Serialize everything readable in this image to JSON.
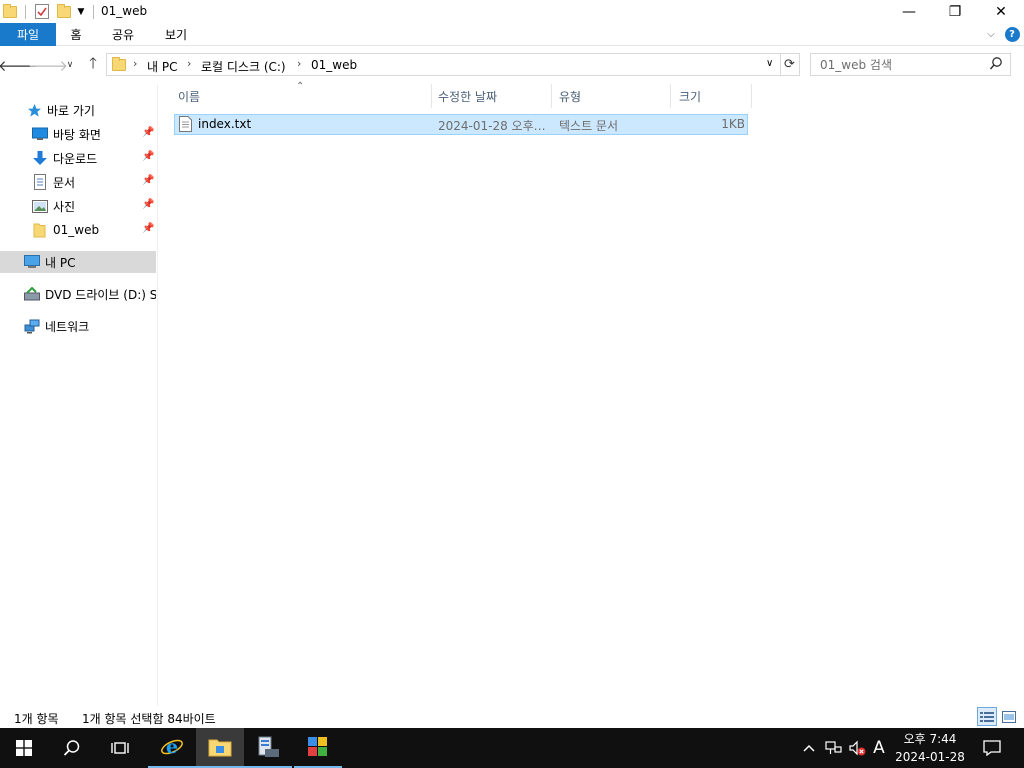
{
  "window": {
    "title": "01_web",
    "minimize": "—",
    "restore": "❐",
    "close": "✕"
  },
  "ribbon": {
    "tabs": [
      {
        "label": "파일"
      },
      {
        "label": "홈"
      },
      {
        "label": "공유"
      },
      {
        "label": "보기"
      }
    ],
    "accent": "#1979ca",
    "help": "?"
  },
  "address": {
    "crumbs": [
      "내 PC",
      "로컬 디스크 (C:)",
      "01_web"
    ]
  },
  "search": {
    "placeholder": "01_web 검색"
  },
  "nav": {
    "quick_access": "바로 가기",
    "items": [
      {
        "label": "바탕 화면",
        "icon": "desktop-icon"
      },
      {
        "label": "다운로드",
        "icon": "download-icon"
      },
      {
        "label": "문서",
        "icon": "documents-icon"
      },
      {
        "label": "사진",
        "icon": "pictures-icon"
      },
      {
        "label": "01_web",
        "icon": "folder-icon"
      }
    ],
    "this_pc": "내 PC",
    "dvd": "DVD 드라이브 (D:) S",
    "network": "네트워크"
  },
  "columns": {
    "name": "이름",
    "modified": "수정한 날짜",
    "type": "유형",
    "size": "크기"
  },
  "files": [
    {
      "name": "index.txt",
      "modified": "2024-01-28 오후…",
      "type": "텍스트 문서",
      "size": "1KB"
    }
  ],
  "status": {
    "count": "1개 항목",
    "selected": "1개 항목 선택함 84바이트"
  },
  "tray": {
    "ime": "A",
    "time": "오후 7:44",
    "date": "2024-01-28"
  },
  "colors": {
    "selection_bg": "#cce8ff",
    "selection_border": "#99d1ff",
    "taskbar": "#101010"
  }
}
